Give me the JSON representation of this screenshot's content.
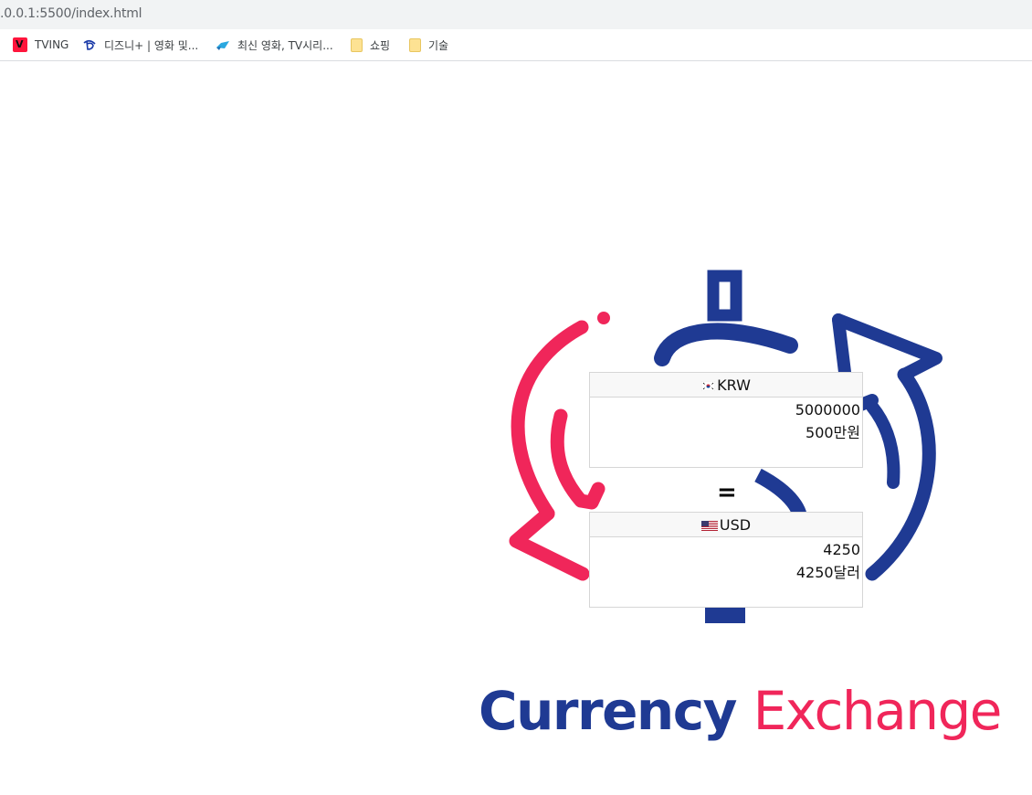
{
  "browser": {
    "url": ".0.0.1:5500/index.html",
    "bookmarks": [
      {
        "label": "TVING",
        "icon": "tving-icon"
      },
      {
        "label": "디즈니+ | 영화 및...",
        "icon": "disney-plus-icon"
      },
      {
        "label": "최신 영화, TV시리...",
        "icon": "fish-icon"
      },
      {
        "label": "쇼핑",
        "icon": "folder-icon"
      },
      {
        "label": "기술",
        "icon": "folder-icon"
      }
    ]
  },
  "converter": {
    "from": {
      "flag": "kr-flag-icon",
      "currency": "KRW",
      "amount": "5000000",
      "formatted": "500만원"
    },
    "separator": "=",
    "to": {
      "flag": "us-flag-icon",
      "currency": "USD",
      "amount": "4250",
      "formatted": "4250달러"
    }
  },
  "brand": {
    "word1": "Currency",
    "word2": "Exchange"
  },
  "colors": {
    "navy": "#1f3a93",
    "pink": "#f0265a"
  }
}
